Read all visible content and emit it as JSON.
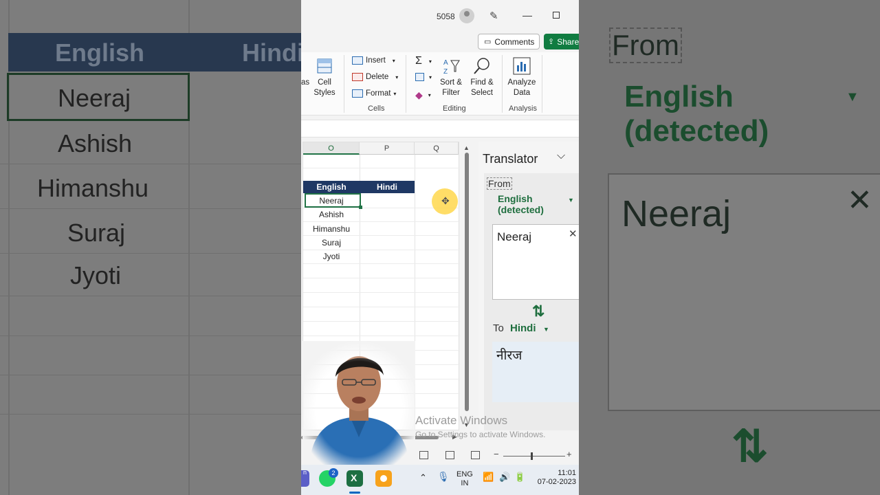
{
  "background": {
    "left_header": [
      "English",
      "Hindi"
    ],
    "left_names": [
      "Neeraj",
      "Ashish",
      "Himanshu",
      "Suraj",
      "Jyoti"
    ],
    "right_from": "From",
    "right_lang": "English (detected)",
    "right_input": "Neeraj"
  },
  "titlebar": {
    "count": "5058"
  },
  "buttons": {
    "comments": "Comments",
    "share": "Share"
  },
  "ribbon": {
    "cell_styles": "Cell Styles",
    "insert": "Insert",
    "delete": "Delete",
    "format": "Format",
    "sort_filter": "Sort & Filter",
    "find_select": "Find & Select",
    "analyze": "Analyze Data",
    "groups": {
      "cells": "Cells",
      "editing": "Editing",
      "analysis": "Analysis"
    },
    "truncated_label": "as"
  },
  "sheet": {
    "columns": [
      "O",
      "P",
      "Q"
    ],
    "headers": [
      "English",
      "Hindi"
    ],
    "names": [
      "Neeraj",
      "Ashish",
      "Himanshu",
      "Suraj",
      "Jyoti"
    ]
  },
  "translator": {
    "title": "Translator",
    "from_label": "From",
    "from_lang": "English (detected)",
    "input_text": "Neeraj",
    "to_label": "To",
    "to_lang": "Hindi",
    "output_text": "नीरज"
  },
  "watermark": {
    "line1": "Activate Windows",
    "line2": "Go to Settings to activate Windows."
  },
  "taskbar": {
    "whatsapp_badge": "2",
    "lang": "ENG",
    "region": "IN",
    "time": "11:01",
    "date": "07-02-2023"
  },
  "colors": {
    "excel_green": "#217346",
    "header_navy": "#1f3864",
    "share_green": "#107c41"
  }
}
